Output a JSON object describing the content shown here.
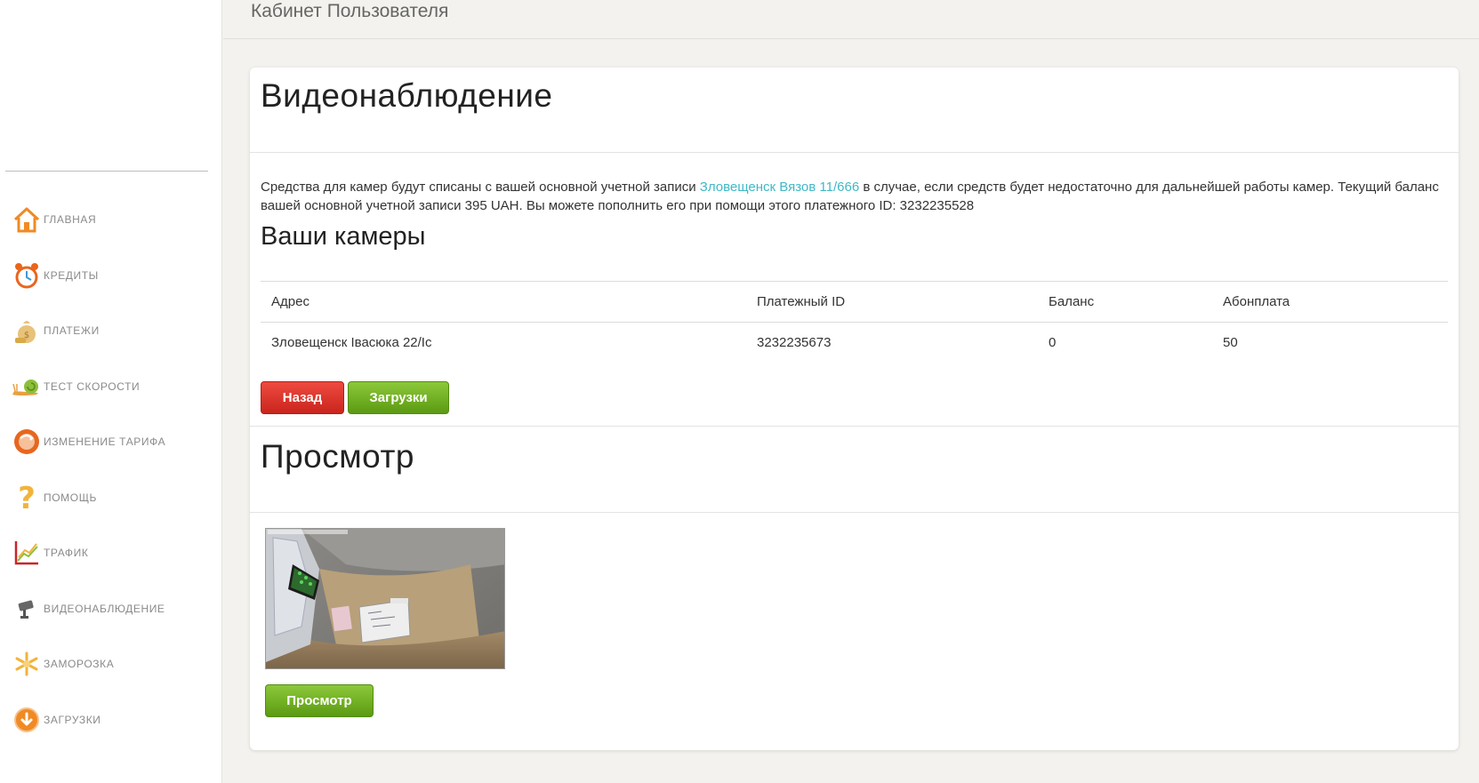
{
  "header": {
    "title": "Кабинет Пользователя"
  },
  "sidebar": {
    "items": [
      {
        "label": "ГЛАВНАЯ",
        "icon": "home-icon"
      },
      {
        "label": "КРЕДИТЫ",
        "icon": "alarm-clock-icon"
      },
      {
        "label": "ПЛАТЕЖИ",
        "icon": "money-bag-icon"
      },
      {
        "label": "ТЕСТ СКОРОСТИ",
        "icon": "snail-icon"
      },
      {
        "label": "ИЗМЕНЕНИЕ ТАРИФА",
        "icon": "tariff-icon"
      },
      {
        "label": "ПОМОЩЬ",
        "icon": "question-icon"
      },
      {
        "label": "ТРАФИК",
        "icon": "traffic-chart-icon"
      },
      {
        "label": "ВИДЕОНАБЛЮДЕНИЕ",
        "icon": "camera-icon"
      },
      {
        "label": "ЗАМОРОЗКА",
        "icon": "snowflake-icon"
      },
      {
        "label": "ЗАГРУЗКИ",
        "icon": "download-icon"
      }
    ]
  },
  "main": {
    "title": "Видеонаблюдение",
    "info": {
      "text_before": "Средства для камер будут списаны с вашей основной учетной записи ",
      "link": "Зловещенск Вязов 11/666",
      "text_after": " в случае, если средств будет недостаточно для дальнейшей работы камер. Текущий баланс вашей основной учетной записи 395 UAH. Вы можете пополнить его при помощи этого платежного ID: 3232235528"
    },
    "cameras_title": "Ваши камеры",
    "table": {
      "headers": [
        "Адрес",
        "Платежный ID",
        "Баланс",
        "Абонплата"
      ],
      "rows": [
        [
          "Зловещенск Івасюка 22/Ic",
          "3232235673",
          "0",
          "50"
        ]
      ]
    },
    "buttons": {
      "back": "Назад",
      "downloads": "Загрузки"
    },
    "preview_title": "Просмотр",
    "preview_button": "Просмотр"
  },
  "colors": {
    "link": "#3fb8c6",
    "button_red": "#d9342b",
    "button_green": "#6fae22",
    "icon_orange": "#f08a24"
  }
}
